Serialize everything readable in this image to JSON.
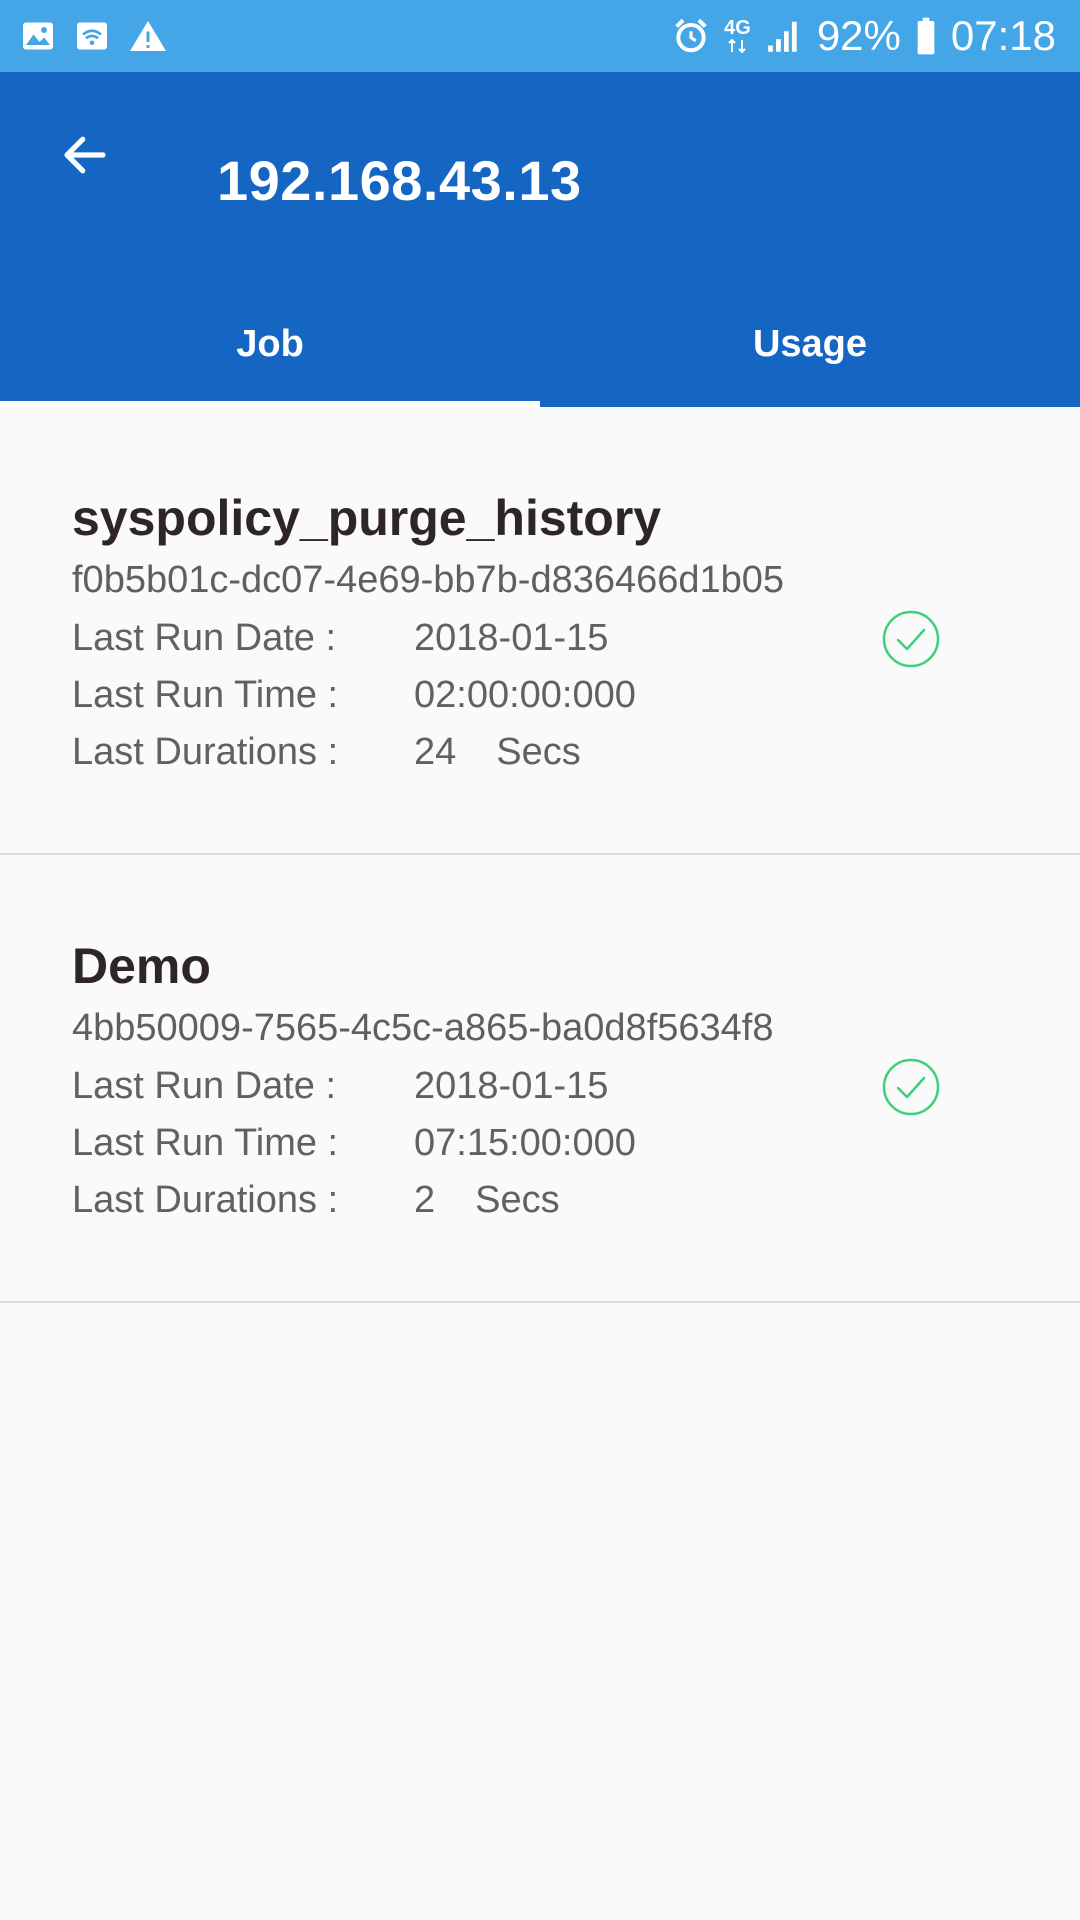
{
  "status_bar": {
    "battery": "92%",
    "time": "07:18",
    "network": "4G",
    "icons": [
      "image-icon",
      "wifi-icon",
      "warning-icon",
      "alarm-icon",
      "network-4g-icon",
      "signal-icon",
      "battery-icon"
    ]
  },
  "app_bar": {
    "title": "192.168.43.13",
    "back_icon": "arrow-back-icon"
  },
  "tabs": [
    {
      "label": "Job",
      "active": true
    },
    {
      "label": "Usage",
      "active": false
    }
  ],
  "jobs": [
    {
      "name": "syspolicy_purge_history",
      "id": "f0b5b01c-dc07-4e69-bb7b-d836466d1b05",
      "last_run_date_label": "Last Run Date :",
      "last_run_date": "2018-01-15",
      "last_run_time_label": "Last Run Time :",
      "last_run_time": "02:00:00:000",
      "last_duration_label": "Last Durations :",
      "last_duration": "24",
      "duration_unit": "Secs",
      "status_icon": "check-circle-icon"
    },
    {
      "name": "Demo",
      "id": "4bb50009-7565-4c5c-a865-ba0d8f5634f8",
      "last_run_date_label": "Last Run Date :",
      "last_run_date": "2018-01-15",
      "last_run_time_label": "Last Run Time :",
      "last_run_time": "07:15:00:000",
      "last_duration_label": "Last Durations :",
      "last_duration": "2",
      "duration_unit": "Secs",
      "status_icon": "check-circle-icon"
    }
  ],
  "colors": {
    "status_bar": "#44a6e6",
    "app_bar": "#1565c2",
    "success": "#3ecf7a",
    "background": "#fafafa"
  }
}
